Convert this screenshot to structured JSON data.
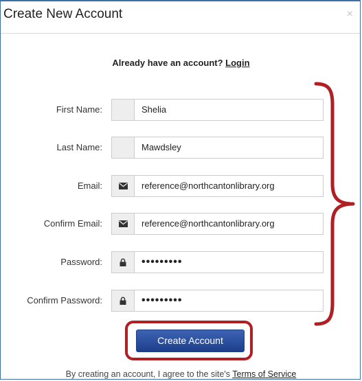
{
  "dialog": {
    "title": "Create New Account",
    "close_glyph": "×"
  },
  "login": {
    "prompt": "Already have an account?",
    "link_label": "Login"
  },
  "fields": [
    {
      "label": "First Name:",
      "value": "Shelia",
      "icon": ""
    },
    {
      "label": "Last Name:",
      "value": "Mawdsley",
      "icon": ""
    },
    {
      "label": "Email:",
      "value": "reference@northcantonlibrary.org",
      "icon": "envelope-icon"
    },
    {
      "label": "Confirm Email:",
      "value": "reference@northcantonlibrary.org",
      "icon": "envelope-icon"
    },
    {
      "label": "Password:",
      "value": "•••••••••",
      "icon": "lock-icon"
    },
    {
      "label": "Confirm Password:",
      "value": "•••••••••",
      "icon": "lock-icon"
    }
  ],
  "submit": {
    "label": "Create Account"
  },
  "terms": {
    "prefix": "By creating an account, I agree to the site's",
    "link_label": "Terms of Service"
  },
  "colors": {
    "annotation": "#b01f24",
    "button": "#2a4f9e",
    "frame": "#3a6fa8"
  }
}
